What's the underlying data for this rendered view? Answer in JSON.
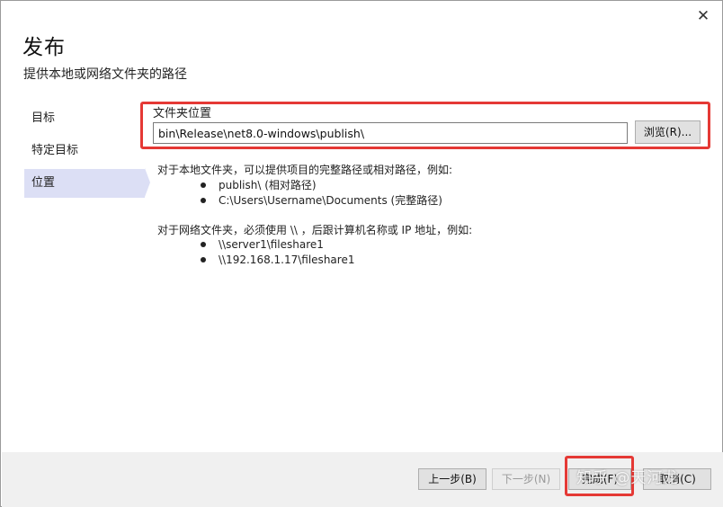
{
  "dialog": {
    "title": "发布",
    "subtitle": "提供本地或网络文件夹的路径",
    "close_glyph": "✕"
  },
  "sidebar": {
    "items": [
      {
        "label": "目标",
        "selected": false
      },
      {
        "label": "特定目标",
        "selected": false
      },
      {
        "label": "位置",
        "selected": true
      }
    ]
  },
  "location": {
    "label": "文件夹位置",
    "path_value": "bin\\Release\\net8.0-windows\\publish\\",
    "browse_label": "浏览(R)..."
  },
  "help": {
    "local_intro": "对于本地文件夹，可以提供项目的完整路径或相对路径，例如:",
    "local_examples": [
      "publish\\ (相对路径)",
      "C:\\Users\\Username\\Documents (完整路径)"
    ],
    "network_intro": "对于网络文件夹，必须使用 \\\\ ，后跟计算机名称或 IP 地址，例如:",
    "network_examples": [
      "\\\\server1\\fileshare1",
      "\\\\192.168.1.17\\fileshare1"
    ]
  },
  "footer": {
    "back_label": "上一步(B)",
    "next_label": "下一步(N)",
    "finish_label": "完成(F)",
    "cancel_label": "取消(C)"
  },
  "watermark": "知乎 @天河龙",
  "colors": {
    "selection": "#dcdff5",
    "highlight": "#e53935"
  }
}
